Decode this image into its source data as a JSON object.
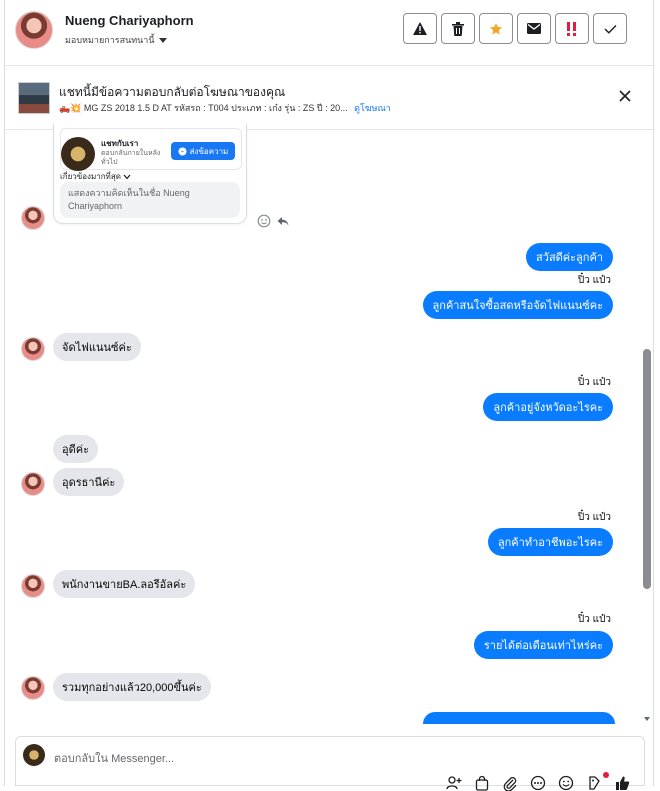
{
  "header": {
    "name": "Nueng Chariyaphorn",
    "assign_label": "มอบหมายการสนทนานี้",
    "actions": [
      "warning-icon",
      "trash-icon",
      "star-icon",
      "mail-icon",
      "urgent-icon",
      "check-icon"
    ]
  },
  "ad_banner": {
    "title": "แชทนี้มีข้อความตอบกลับต่อโฆษณาของคุณ",
    "subtitle": "🛻💥 MG ZS 2018 1.5 D AT รหัสรถ : T004 ประเภท : เก๋ง รุ่น : ZS ปี : 20...",
    "view_ad": "ดูโฆษณา"
  },
  "ad_card": {
    "page_name": "แชทกับเรา",
    "page_desc": "ตอบกลับภายในหลัง ทั่วไป",
    "send_button": "ส่งข้อความ",
    "more_label": "เกี่ยวข้องมากที่สุด",
    "note": "แสดงความคิดเห็นในชื่อ Nueng Chariyaphorn"
  },
  "messages": [
    {
      "dir": "out",
      "text": "สวัสดีค่ะลูกค้า"
    },
    {
      "dir": "out",
      "sender": "ปิ๋ว แป๋ว",
      "text": "ลูกค้าสนใจซื้อสดหรือจัดไฟแนนซ์คะ"
    },
    {
      "dir": "in",
      "text": "จัดไฟแนนซ์ค่ะ"
    },
    {
      "dir": "out",
      "sender": "ปิ๋ว แป๋ว",
      "text": "ลูกค้าอยู่จังหวัดอะไรคะ"
    },
    {
      "dir": "in",
      "text": "อุดีค่ะ"
    },
    {
      "dir": "in",
      "text": "อุดรธานีค่ะ"
    },
    {
      "dir": "out",
      "sender": "ปิ๋ว แป๋ว",
      "text": "ลูกค้าทำอาชีพอะไรคะ"
    },
    {
      "dir": "in",
      "text": "พนักงานขายBA.ลอรีอัลค่ะ"
    },
    {
      "dir": "out",
      "sender": "ปิ๋ว แป๋ว",
      "text": "รายได้ต่อเดือนเท่าไหร่คะ"
    },
    {
      "dir": "in",
      "text": "รวมทุกอย่างแล้ว20,000ขึ้นค่ะ"
    }
  ],
  "composer": {
    "placeholder": "ตอบกลับใน Messenger..."
  },
  "colors": {
    "outgoing_bubble": "#0a7cff",
    "incoming_bubble": "#e4e6eb",
    "accent": "#1877f2",
    "star": "#f5a623",
    "urgent": "#e41e3f"
  }
}
